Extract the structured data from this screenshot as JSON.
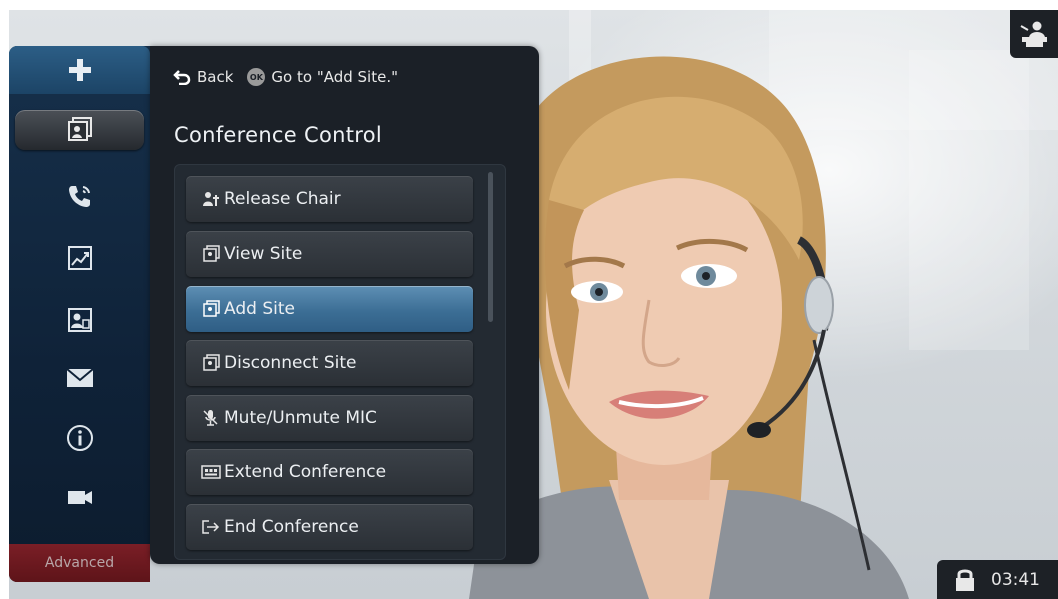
{
  "sidebar": {
    "items": [
      {
        "icon": "plus-icon"
      },
      {
        "icon": "view-site-icon",
        "active": true
      },
      {
        "icon": "phone-icon"
      },
      {
        "icon": "chart-icon"
      },
      {
        "icon": "contacts-icon"
      },
      {
        "icon": "mail-icon"
      },
      {
        "icon": "info-icon"
      },
      {
        "icon": "camera-icon"
      }
    ],
    "advanced_label": "Advanced"
  },
  "panel": {
    "back_label": "Back",
    "ok_badge": "OK",
    "hint_text": "Go to \"Add Site.\"",
    "title": "Conference Control",
    "items": [
      {
        "label": "Release Chair",
        "icon": "release-chair-icon"
      },
      {
        "label": "View Site",
        "icon": "view-site-icon"
      },
      {
        "label": "Add Site",
        "icon": "add-site-icon",
        "selected": true
      },
      {
        "label": "Disconnect Site",
        "icon": "disconnect-site-icon"
      },
      {
        "label": "Mute/Unmute MIC",
        "icon": "microphone-icon"
      },
      {
        "label": "Extend Conference",
        "icon": "extend-conference-icon"
      },
      {
        "label": "End Conference",
        "icon": "end-conference-icon"
      }
    ]
  },
  "status": {
    "time": "03:41",
    "lock_icon": "lock-icon",
    "presenter_icon": "presenter-icon"
  },
  "colors": {
    "selected_item": "#3c6e95",
    "advanced_bg": "#6a1a20",
    "panel_bg": "#1b2027",
    "sidebar_bg": "#0f2238"
  }
}
